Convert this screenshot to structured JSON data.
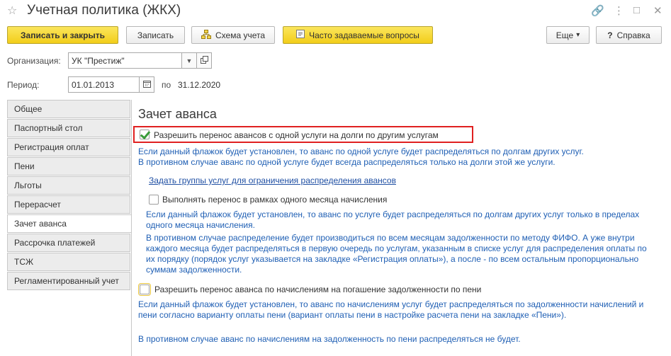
{
  "window": {
    "title": "Учетная политика (ЖКХ)",
    "star_icon": "☆",
    "link_icon": "🔗",
    "menu_icon": "⋮",
    "minimize_icon": "□",
    "close_icon": "✕"
  },
  "toolbar": {
    "save_close": "Записать и закрыть",
    "save": "Записать",
    "scheme": "Схема учета",
    "faq": "Часто задаваемые вопросы",
    "more": "Еще",
    "more_arrow": "▾",
    "help": "Справка",
    "help_icon": "?"
  },
  "form": {
    "org_label": "Организация:",
    "org_value": "УК \"Престиж\"",
    "period_label": "Период:",
    "period_from": "01.01.2013",
    "period_to_label": "по",
    "period_to": "31.12.2020"
  },
  "tabs": [
    {
      "label": "Общее"
    },
    {
      "label": "Паспортный стол"
    },
    {
      "label": "Регистрация оплат"
    },
    {
      "label": "Пени"
    },
    {
      "label": "Льготы"
    },
    {
      "label": "Перерасчет"
    },
    {
      "label": "Зачет аванса"
    },
    {
      "label": "Рассрочка платежей"
    },
    {
      "label": "ТСЖ"
    },
    {
      "label": "Регламентированный учет"
    }
  ],
  "content": {
    "title": "Зачет аванса",
    "opt1_label": "Разрешить перенос авансов с одной услуги на долги по другим услугам",
    "opt1_checked": true,
    "opt1_hint1": "Если данный флажок будет установлен, то аванс по одной услуге будет распределяться по долгам других услуг.",
    "opt1_hint2": "В противном случае аванс по одной услуге будет всегда распределяться только на долги этой же услуги.",
    "groups_link": "Задать группы услуг для ограничения распределения авансов",
    "opt2_label": "Выполнять перенос в рамках одного месяца начисления",
    "opt2_checked": false,
    "opt2_hint1": "Если данный флажок будет установлен, то аванс по услуге будет распределяться по долгам других услуг только в пределах одного месяца начисления.",
    "opt2_hint2": "В противном случае распределение будет производиться по всем месяцам задолженности по методу ФИФО. А уже внутри каждого месяца будет распределяться в первую очередь по услугам, указанным в списке услуг для распределения оплаты по их порядку (порядок услуг указывается на закладке «Регистрация оплаты»), а после - по всем остальным пропорционально суммам задолженности.",
    "opt3_label": "Разрешить перенос аванса по начислениям на погашение задолженности по пени",
    "opt3_checked": false,
    "opt3_hint1": "Если данный флажок будет установлен, то аванс по начислениям услуг будет распределяться по задолженности начислений и пени согласно варианту оплаты пени (вариант оплаты пени в настройке расчета пени на закладке «Пени»).",
    "opt3_hint2": "В противном случае аванс по начислениям на задолженность по пени распределяться не будет."
  }
}
